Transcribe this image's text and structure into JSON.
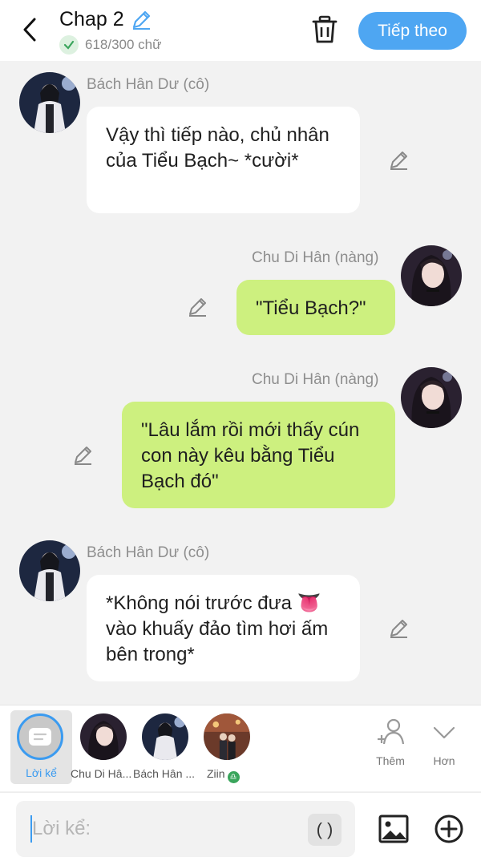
{
  "header": {
    "title": "Chap 2",
    "word_count": "618/300 chữ",
    "next_label": "Tiếp theo"
  },
  "messages": [
    {
      "speaker": "Bách Hân Dư (cô)",
      "text": "Vậy thì tiếp nào, chủ nhân của Tiểu Bạch~ *cười*",
      "side": "left"
    },
    {
      "speaker": "Chu Di Hân (nàng)",
      "text": "\"Tiểu Bạch?\"",
      "side": "right"
    },
    {
      "speaker": "Chu Di Hân (nàng)",
      "text": "\"Lâu lắm rồi mới thấy cún con này kêu bằng Tiểu Bạch đó\"",
      "side": "right"
    },
    {
      "speaker": "Bách Hân Dư (cô)",
      "text": "*Không nói trước đưa 👅 vào khuấy đảo tìm hơi ấm bên trong*",
      "side": "left"
    }
  ],
  "characters": {
    "narration": "Lời kể",
    "items": [
      "Chu Di Hâ...",
      "Bách Hân ...",
      "Ziin"
    ],
    "add_label": "Thêm",
    "more_label": "Hơn"
  },
  "input": {
    "placeholder": "Lời kể:",
    "paren_label": "( )"
  },
  "colors": {
    "accent": "#4ea6f2",
    "green_bubble": "#cdf07f",
    "white_bubble": "#ffffff",
    "background": "#f2f2f2"
  }
}
